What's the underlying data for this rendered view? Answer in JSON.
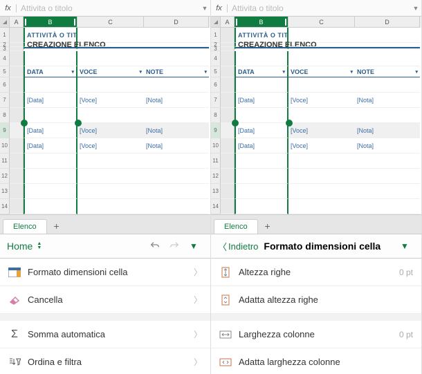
{
  "formula_bar": {
    "placeholder": "Attivita o titolo"
  },
  "columns": {
    "A": "A",
    "B": "B",
    "C": "C",
    "D": "D"
  },
  "rows": [
    "1",
    "2",
    "3",
    "4",
    "5",
    "6",
    "7",
    "8",
    "9",
    "10",
    "11",
    "12",
    "13",
    "14"
  ],
  "content": {
    "subtitle": "ATTIVITÀ O TITOLO",
    "title": "CREAZIONE ELENCO",
    "headers": {
      "data": "DATA",
      "voce": "VOCE",
      "note": "NOTE"
    },
    "placeholder": {
      "data": "[Data]",
      "voce": "[Voce]",
      "nota": "[Nota]"
    }
  },
  "sheet": {
    "name": "Elenco",
    "add": "+"
  },
  "left_toolbar": {
    "tab": "Home"
  },
  "left_menu": {
    "formato": "Formato dimensioni cella",
    "cancella": "Cancella",
    "somma": "Somma automatica",
    "ordina": "Ordina e filtra"
  },
  "right_toolbar": {
    "back": "Indietro",
    "title": "Formato dimensioni cella"
  },
  "right_menu": {
    "altezza": "Altezza righe",
    "altezza_val": "0 pt",
    "adatta_h": "Adatta altezza righe",
    "larghezza": "Larghezza colonne",
    "larghezza_val": "0 pt",
    "adatta_w": "Adatta larghezza colonne"
  }
}
